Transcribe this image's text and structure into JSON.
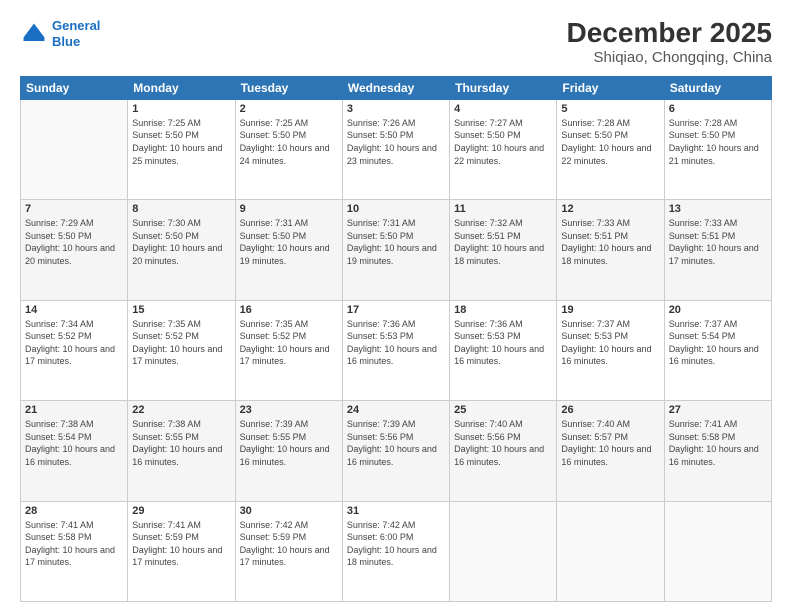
{
  "logo": {
    "line1": "General",
    "line2": "Blue"
  },
  "header": {
    "month": "December 2025",
    "location": "Shiqiao, Chongqing, China"
  },
  "weekdays": [
    "Sunday",
    "Monday",
    "Tuesday",
    "Wednesday",
    "Thursday",
    "Friday",
    "Saturday"
  ],
  "weeks": [
    [
      {
        "day": "",
        "info": ""
      },
      {
        "day": "1",
        "info": "Sunrise: 7:25 AM\nSunset: 5:50 PM\nDaylight: 10 hours\nand 25 minutes."
      },
      {
        "day": "2",
        "info": "Sunrise: 7:25 AM\nSunset: 5:50 PM\nDaylight: 10 hours\nand 24 minutes."
      },
      {
        "day": "3",
        "info": "Sunrise: 7:26 AM\nSunset: 5:50 PM\nDaylight: 10 hours\nand 23 minutes."
      },
      {
        "day": "4",
        "info": "Sunrise: 7:27 AM\nSunset: 5:50 PM\nDaylight: 10 hours\nand 22 minutes."
      },
      {
        "day": "5",
        "info": "Sunrise: 7:28 AM\nSunset: 5:50 PM\nDaylight: 10 hours\nand 22 minutes."
      },
      {
        "day": "6",
        "info": "Sunrise: 7:28 AM\nSunset: 5:50 PM\nDaylight: 10 hours\nand 21 minutes."
      }
    ],
    [
      {
        "day": "7",
        "info": "Sunrise: 7:29 AM\nSunset: 5:50 PM\nDaylight: 10 hours\nand 20 minutes."
      },
      {
        "day": "8",
        "info": "Sunrise: 7:30 AM\nSunset: 5:50 PM\nDaylight: 10 hours\nand 20 minutes."
      },
      {
        "day": "9",
        "info": "Sunrise: 7:31 AM\nSunset: 5:50 PM\nDaylight: 10 hours\nand 19 minutes."
      },
      {
        "day": "10",
        "info": "Sunrise: 7:31 AM\nSunset: 5:50 PM\nDaylight: 10 hours\nand 19 minutes."
      },
      {
        "day": "11",
        "info": "Sunrise: 7:32 AM\nSunset: 5:51 PM\nDaylight: 10 hours\nand 18 minutes."
      },
      {
        "day": "12",
        "info": "Sunrise: 7:33 AM\nSunset: 5:51 PM\nDaylight: 10 hours\nand 18 minutes."
      },
      {
        "day": "13",
        "info": "Sunrise: 7:33 AM\nSunset: 5:51 PM\nDaylight: 10 hours\nand 17 minutes."
      }
    ],
    [
      {
        "day": "14",
        "info": "Sunrise: 7:34 AM\nSunset: 5:52 PM\nDaylight: 10 hours\nand 17 minutes."
      },
      {
        "day": "15",
        "info": "Sunrise: 7:35 AM\nSunset: 5:52 PM\nDaylight: 10 hours\nand 17 minutes."
      },
      {
        "day": "16",
        "info": "Sunrise: 7:35 AM\nSunset: 5:52 PM\nDaylight: 10 hours\nand 17 minutes."
      },
      {
        "day": "17",
        "info": "Sunrise: 7:36 AM\nSunset: 5:53 PM\nDaylight: 10 hours\nand 16 minutes."
      },
      {
        "day": "18",
        "info": "Sunrise: 7:36 AM\nSunset: 5:53 PM\nDaylight: 10 hours\nand 16 minutes."
      },
      {
        "day": "19",
        "info": "Sunrise: 7:37 AM\nSunset: 5:53 PM\nDaylight: 10 hours\nand 16 minutes."
      },
      {
        "day": "20",
        "info": "Sunrise: 7:37 AM\nSunset: 5:54 PM\nDaylight: 10 hours\nand 16 minutes."
      }
    ],
    [
      {
        "day": "21",
        "info": "Sunrise: 7:38 AM\nSunset: 5:54 PM\nDaylight: 10 hours\nand 16 minutes."
      },
      {
        "day": "22",
        "info": "Sunrise: 7:38 AM\nSunset: 5:55 PM\nDaylight: 10 hours\nand 16 minutes."
      },
      {
        "day": "23",
        "info": "Sunrise: 7:39 AM\nSunset: 5:55 PM\nDaylight: 10 hours\nand 16 minutes."
      },
      {
        "day": "24",
        "info": "Sunrise: 7:39 AM\nSunset: 5:56 PM\nDaylight: 10 hours\nand 16 minutes."
      },
      {
        "day": "25",
        "info": "Sunrise: 7:40 AM\nSunset: 5:56 PM\nDaylight: 10 hours\nand 16 minutes."
      },
      {
        "day": "26",
        "info": "Sunrise: 7:40 AM\nSunset: 5:57 PM\nDaylight: 10 hours\nand 16 minutes."
      },
      {
        "day": "27",
        "info": "Sunrise: 7:41 AM\nSunset: 5:58 PM\nDaylight: 10 hours\nand 16 minutes."
      }
    ],
    [
      {
        "day": "28",
        "info": "Sunrise: 7:41 AM\nSunset: 5:58 PM\nDaylight: 10 hours\nand 17 minutes."
      },
      {
        "day": "29",
        "info": "Sunrise: 7:41 AM\nSunset: 5:59 PM\nDaylight: 10 hours\nand 17 minutes."
      },
      {
        "day": "30",
        "info": "Sunrise: 7:42 AM\nSunset: 5:59 PM\nDaylight: 10 hours\nand 17 minutes."
      },
      {
        "day": "31",
        "info": "Sunrise: 7:42 AM\nSunset: 6:00 PM\nDaylight: 10 hours\nand 18 minutes."
      },
      {
        "day": "",
        "info": ""
      },
      {
        "day": "",
        "info": ""
      },
      {
        "day": "",
        "info": ""
      }
    ]
  ]
}
